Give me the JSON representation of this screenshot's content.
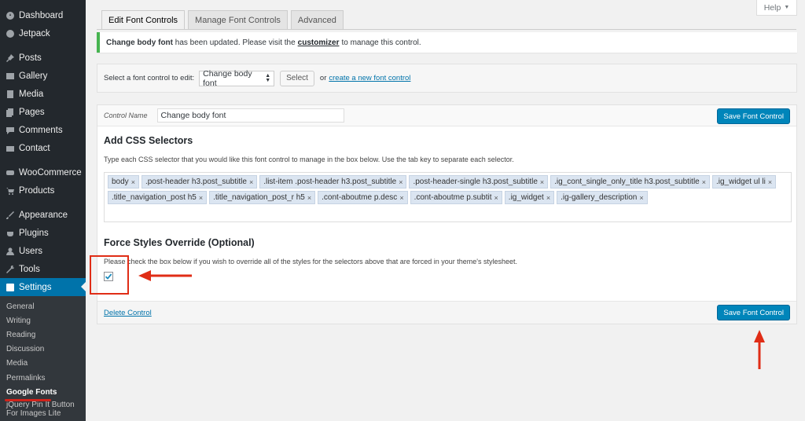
{
  "sidebar": {
    "items": [
      {
        "label": "Dashboard",
        "icon": "dashboard-icon"
      },
      {
        "label": "Jetpack",
        "icon": "jetpack-icon"
      },
      {
        "label": "Posts",
        "icon": "pin-icon"
      },
      {
        "label": "Gallery",
        "icon": "gallery-icon"
      },
      {
        "label": "Media",
        "icon": "media-icon"
      },
      {
        "label": "Pages",
        "icon": "pages-icon"
      },
      {
        "label": "Comments",
        "icon": "comments-icon"
      },
      {
        "label": "Contact",
        "icon": "envelope-icon"
      },
      {
        "label": "WooCommerce",
        "icon": "woocommerce-icon"
      },
      {
        "label": "Products",
        "icon": "cart-icon"
      },
      {
        "label": "Appearance",
        "icon": "brush-icon"
      },
      {
        "label": "Plugins",
        "icon": "plug-icon"
      },
      {
        "label": "Users",
        "icon": "user-icon"
      },
      {
        "label": "Tools",
        "icon": "wrench-icon"
      },
      {
        "label": "Settings",
        "icon": "settings-icon"
      }
    ],
    "submenu": [
      "General",
      "Writing",
      "Reading",
      "Discussion",
      "Media",
      "Permalinks",
      "Google Fonts",
      "jQuery Pin It Button For Images Lite"
    ]
  },
  "help": {
    "label": "Help",
    "caret": "▼"
  },
  "tabs": [
    "Edit Font Controls",
    "Manage Font Controls",
    "Advanced"
  ],
  "notice": {
    "bold": "Change body font",
    "text1": "has been updated. Please visit the",
    "link": "customizer",
    "text2": "to manage this control."
  },
  "select_bar": {
    "label": "Select a font control to edit:",
    "selected": "Change body font",
    "select_button": "Select",
    "or": "or",
    "create_link": "create a new font control"
  },
  "control": {
    "name_label": "Control Name",
    "name_value": "Change body font",
    "save_button": "Save Font Control",
    "css_title": "Add CSS Selectors",
    "css_desc": "Type each CSS selector that you would like this font control to manage in the box below. Use the tab key to separate each selector.",
    "selectors": [
      "body",
      ".post-header h3.post_subtitle",
      ".list-item .post-header h3.post_subtitle",
      ".post-header-single h3.post_subtitle",
      ".ig_cont_single_only_title h3.post_subtitle",
      ".ig_widget ul li",
      ".title_navigation_post h5",
      ".title_navigation_post_r h5",
      ".cont-aboutme p.desc",
      ".cont-aboutme p.subtit",
      ".ig_widget",
      ".ig-gallery_description"
    ],
    "remove_glyph": "×",
    "force_title": "Force Styles Override (Optional)",
    "force_desc": "Please check the box below if you wish to override all of the styles for the selectors above that are forced in your theme's stylesheet.",
    "force_checked": true,
    "delete_link": "Delete Control"
  },
  "colors": {
    "accent": "#0073aa",
    "primary_button": "#0085ba",
    "annotation": "#e02d16",
    "notice_border": "#46b450"
  }
}
